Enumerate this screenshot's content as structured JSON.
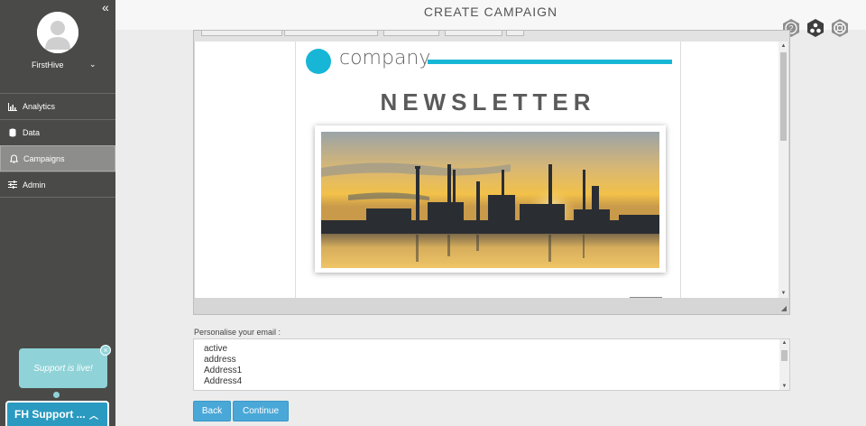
{
  "sidebar": {
    "collapse_icon": "double-chevron-left-icon",
    "user": {
      "name": "FirstHive"
    },
    "items": [
      {
        "label": "Analytics",
        "icon": "bar-chart-icon",
        "active": false
      },
      {
        "label": "Data",
        "icon": "database-icon",
        "active": false
      },
      {
        "label": "Campaigns",
        "icon": "bell-icon",
        "active": true
      },
      {
        "label": "Admin",
        "icon": "sliders-icon",
        "active": false
      }
    ]
  },
  "support": {
    "bubble_text": "Support is live!",
    "bar_label": "FH Support ..."
  },
  "header": {
    "title": "CREATE CAMPAIGN",
    "tool_icons": [
      "help-icon",
      "share-nodes-icon",
      "lifebuoy-icon"
    ]
  },
  "editor": {
    "newsletter": {
      "logo_text": "company",
      "title": "NEWSLETTER",
      "accent_color": "#18b6d6"
    }
  },
  "personalise": {
    "label": "Personalise your email :",
    "fields": [
      "active",
      "address",
      "Address1",
      "Address4"
    ]
  },
  "buttons": {
    "back": "Back",
    "continue": "Continue"
  },
  "colors": {
    "sidebar_bg": "#4a4a48",
    "button_bg": "#4aa8d8",
    "support_bar": "#2a9ac0",
    "support_bubble": "#8fd3d8"
  }
}
